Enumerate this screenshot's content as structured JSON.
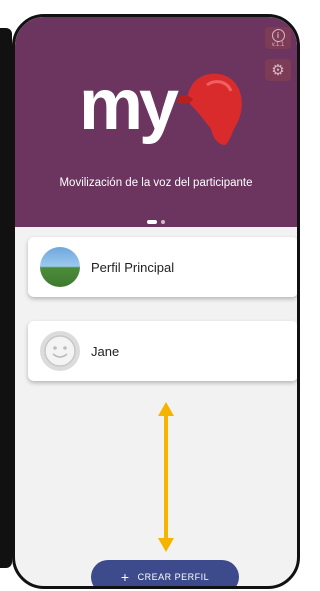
{
  "header": {
    "logo_text": "my",
    "info_label": "v.1.1",
    "tagline": "Movilización de la voz del participante"
  },
  "carousel": {
    "total_pages": 2,
    "active_page": 1
  },
  "profiles": [
    {
      "name": "Perfil Principal",
      "avatar": "landscape-photo"
    },
    {
      "name": "Jane",
      "avatar": "smiley-face-icon"
    }
  ],
  "actions": {
    "create_profile_label": "CREAR PERFIL",
    "create_profile_icon": "plus-icon"
  },
  "colors": {
    "header_bg": "#6b3560",
    "button_bg": "#3d4a8b",
    "arrow": "#f5b400",
    "logo_cap": "#d92b2b"
  }
}
